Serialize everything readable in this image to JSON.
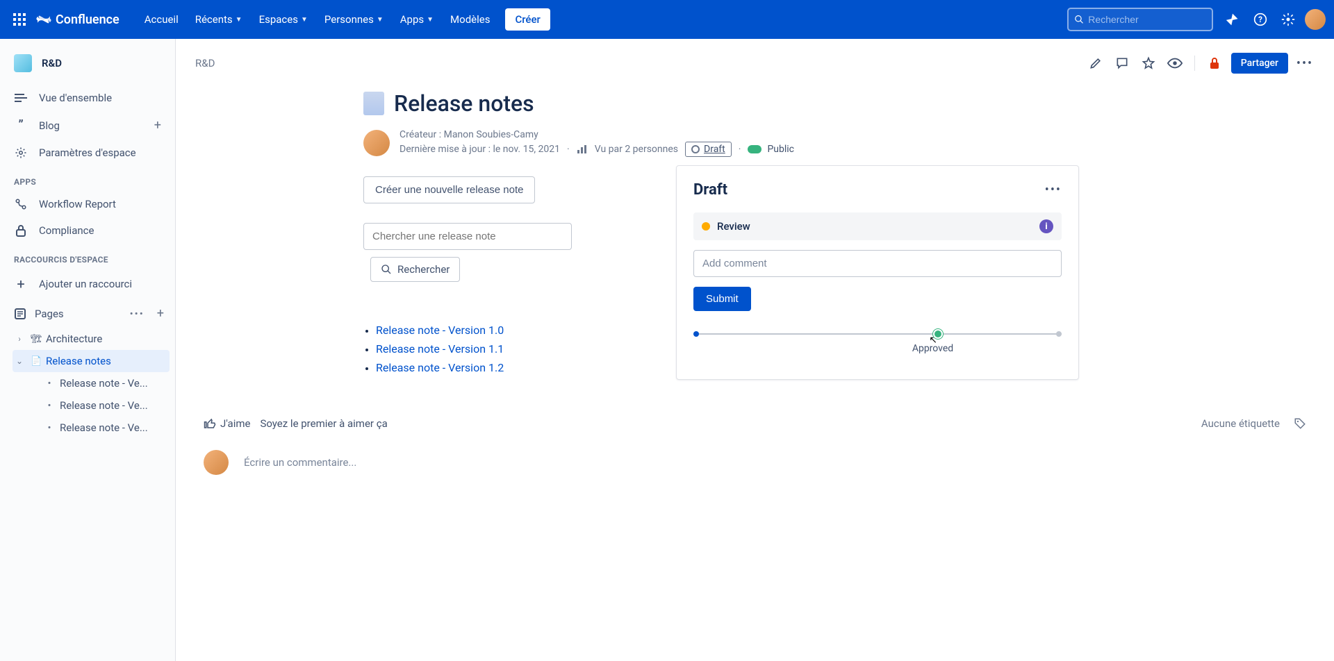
{
  "nav": {
    "product": "Confluence",
    "items": [
      "Accueil",
      "Récents",
      "Espaces",
      "Personnes",
      "Apps",
      "Modèles"
    ],
    "create": "Créer",
    "search_placeholder": "Rechercher"
  },
  "sidebar": {
    "space": "R&D",
    "overview": "Vue d'ensemble",
    "blog": "Blog",
    "settings": "Paramètres d'espace",
    "apps_label": "APPS",
    "apps": [
      "Workflow Report",
      "Compliance"
    ],
    "shortcuts_label": "RACCOURCIS D'ESPACE",
    "add_shortcut": "Ajouter un raccourci",
    "pages_label": "Pages",
    "tree": {
      "architecture": "Architecture",
      "release_notes": "Release notes",
      "children": [
        "Release note - Ve...",
        "Release note - Ve...",
        "Release note - Ve..."
      ]
    }
  },
  "page": {
    "breadcrumb": "R&D",
    "share": "Partager",
    "title": "Release notes",
    "creator_label": "Créateur :",
    "creator": "Manon Soubies-Camy",
    "updated_label": "Dernière mise à jour :",
    "updated": "le nov. 15, 2021",
    "views": "Vu par 2 personnes",
    "status": "Draft",
    "visibility": "Public",
    "create_note": "Créer une nouvelle release note",
    "search_placeholder": "Chercher une release note",
    "search_action": "Rechercher",
    "notes": [
      "Release note - Version 1.0",
      "Release note - Version 1.1",
      "Release note - Version 1.2"
    ]
  },
  "workflow": {
    "title": "Draft",
    "review": "Review",
    "comment_placeholder": "Add comment",
    "submit": "Submit",
    "approved": "Approved"
  },
  "footer": {
    "like": "J'aime",
    "like_prompt": "Soyez le premier à aimer ça",
    "no_labels": "Aucune étiquette",
    "comment_placeholder": "Écrire un commentaire..."
  }
}
